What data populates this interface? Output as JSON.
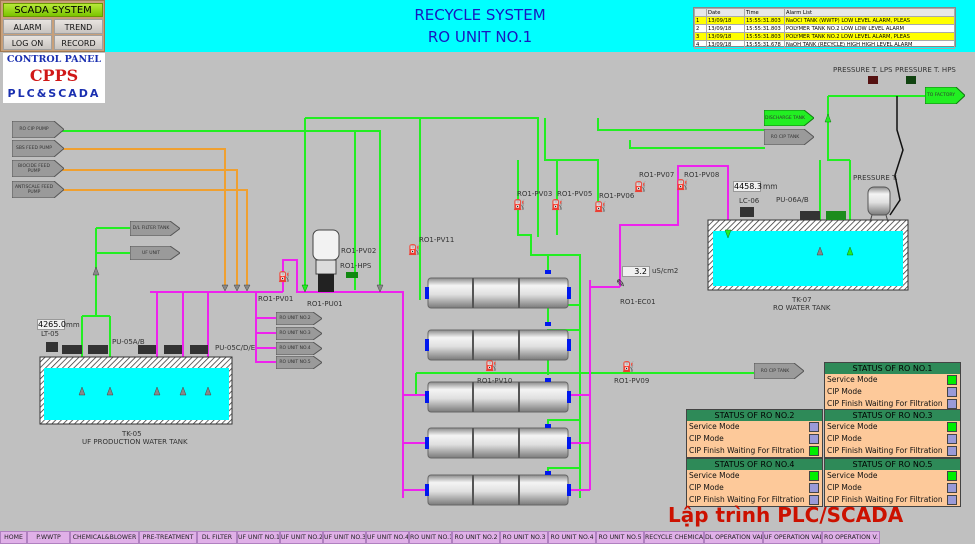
{
  "scada": {
    "title": "SCADA SYSTEM",
    "buttons": [
      "ALARM",
      "TREND",
      "LOG ON",
      "RECORD"
    ]
  },
  "logo": {
    "line1": "CONTROL PANEL",
    "line2": "CPPS",
    "line3": "PLC&SCADA"
  },
  "header": {
    "title": "RECYCLE SYSTEM",
    "subtitle": "RO UNIT NO.1",
    "background": "#00ffff"
  },
  "alarm_list": {
    "columns": [
      "",
      "Date",
      "Time",
      "Alarm List"
    ],
    "rows": [
      {
        "n": "1",
        "date": "13/09/18",
        "time": "15:55:31.803",
        "text": "NaOCl TANK (WWTP) LOW LEVEL ALARM, PLEAS",
        "highlight": true
      },
      {
        "n": "2",
        "date": "13/09/18",
        "time": "15:55:31.803",
        "text": "POLYMER TANK NO.2 LOW LOW LEVEL ALARM",
        "highlight": false
      },
      {
        "n": "3",
        "date": "13/09/18",
        "time": "15:55:31.803",
        "text": "POLYMER TANK NO.2 LOW LEVEL ALARM, PLEAS",
        "highlight": true
      },
      {
        "n": "4",
        "date": "13/09/18",
        "time": "15:55:31.678",
        "text": "NaOH TANK (RECYCLE) HIGH HIGH LEVEL ALARM",
        "highlight": false
      }
    ]
  },
  "tags": {
    "ro_cip_pump": "RO CIP PUMP",
    "sbs_feed_pump": "SBS FEED PUMP",
    "biocide_feed_pump": "BIOCIDE FEED PUMP",
    "antiscale_feed_pump": "ANTISCALE FEED PUMP",
    "dl_filter_tank": "D/L FILTER TANK",
    "uf_unit": "UF UNIT",
    "ro_unit_2": "RO UNIT NO.2",
    "ro_unit_3": "RO UNIT NO.3",
    "ro_unit_4": "RO UNIT NO.4",
    "ro_unit_5": "RO UNIT NO.5",
    "discharge_tank": "DISCHARGE TANK",
    "ro_cip_tank": "RO CIP TANK",
    "to_factory": "TO FACTORY",
    "ro_cip_tank_2": "RO CIP TANK"
  },
  "labels": {
    "pv01": "RO1-PV01",
    "pu01": "RO1-PU01",
    "pv02": "RO1-PV02",
    "hps": "RO1-HPS",
    "pv11": "RO1-PV11",
    "pv03": "RO1-PV03",
    "pv05": "RO1-PV05",
    "pv06": "RO1-PV06",
    "pv07": "RO1-PV07",
    "pv08": "RO1-PV08",
    "pv10": "RO1-PV10",
    "pv09": "RO1-PV09",
    "ec01": "RO1-EC01",
    "pressure_lps": "PRESSURE T. LPS",
    "pressure_hps": "PRESSURE T. HPS",
    "pressure_tank": "PRESSURE T.",
    "lc06": "LC-06",
    "pu06": "PU-06A/B",
    "tk07_id": "TK-07",
    "tk07_name": "RO WATER TANK",
    "lt05": "LT-05",
    "pu05ab": "PU-05A/B",
    "pu05cde": "PU-05C/D/E",
    "tk05_id": "TK-05",
    "tk05_name": "UF PRODUCTION WATER TANK"
  },
  "readouts": {
    "tk07_level": "4458.3",
    "tk07_unit": "mm",
    "tk05_level": "4265.0",
    "tk05_unit": "mm",
    "conductivity": "3.2",
    "conductivity_unit": "uS/cm2"
  },
  "status_panels": [
    {
      "title": "STATUS OF RO NO.1",
      "rows": [
        {
          "label": "Service Mode",
          "on": true
        },
        {
          "label": "CIP Mode",
          "on": false
        },
        {
          "label": "CIP Finish Waiting For Filtration",
          "on": false
        }
      ]
    },
    {
      "title": "STATUS OF RO NO.2",
      "rows": [
        {
          "label": "Service Mode",
          "on": false
        },
        {
          "label": "CIP Mode",
          "on": false
        },
        {
          "label": "CIP Finish Waiting For Filtration",
          "on": true
        }
      ]
    },
    {
      "title": "STATUS OF RO NO.3",
      "rows": [
        {
          "label": "Service Mode",
          "on": true
        },
        {
          "label": "CIP Mode",
          "on": false
        },
        {
          "label": "CIP Finish Waiting For Filtration",
          "on": false
        }
      ]
    },
    {
      "title": "STATUS OF RO NO.4",
      "rows": [
        {
          "label": "Service Mode",
          "on": true
        },
        {
          "label": "CIP Mode",
          "on": false
        },
        {
          "label": "CIP Finish Waiting For Filtration",
          "on": false
        }
      ]
    },
    {
      "title": "STATUS OF RO NO.5",
      "rows": [
        {
          "label": "Service Mode",
          "on": true
        },
        {
          "label": "CIP Mode",
          "on": false
        },
        {
          "label": "CIP Finish Waiting For Filtration",
          "on": false
        }
      ]
    }
  ],
  "colors": {
    "indicator_on": "#00ee00",
    "indicator_off": "#9a9ad8",
    "pipe_green": "#22ee22",
    "pipe_magenta": "#ee22ee",
    "pipe_orange": "#f0a030",
    "water": "#00ffff"
  },
  "nav": [
    "HOME",
    "P.WWTP",
    "CHEMICAL&BLOWER",
    "PRE-TREATMENT",
    "DL FILTER",
    "UF UNIT NO.1",
    "UF UNIT NO.2",
    "UF UNIT NO.3",
    "UF UNIT NO.4",
    "RO UNIT NO.1",
    "RO UNIT NO.2",
    "RO UNIT NO.3",
    "RO UNIT NO.4",
    "RO UNIT NO.5",
    "RECYCLE CHEMICAL",
    "DL OPERATION VALVE",
    "UF OPERATION VALVE",
    "RO OPERATION V."
  ],
  "watermark": "Lập trình PLC/SCADA"
}
